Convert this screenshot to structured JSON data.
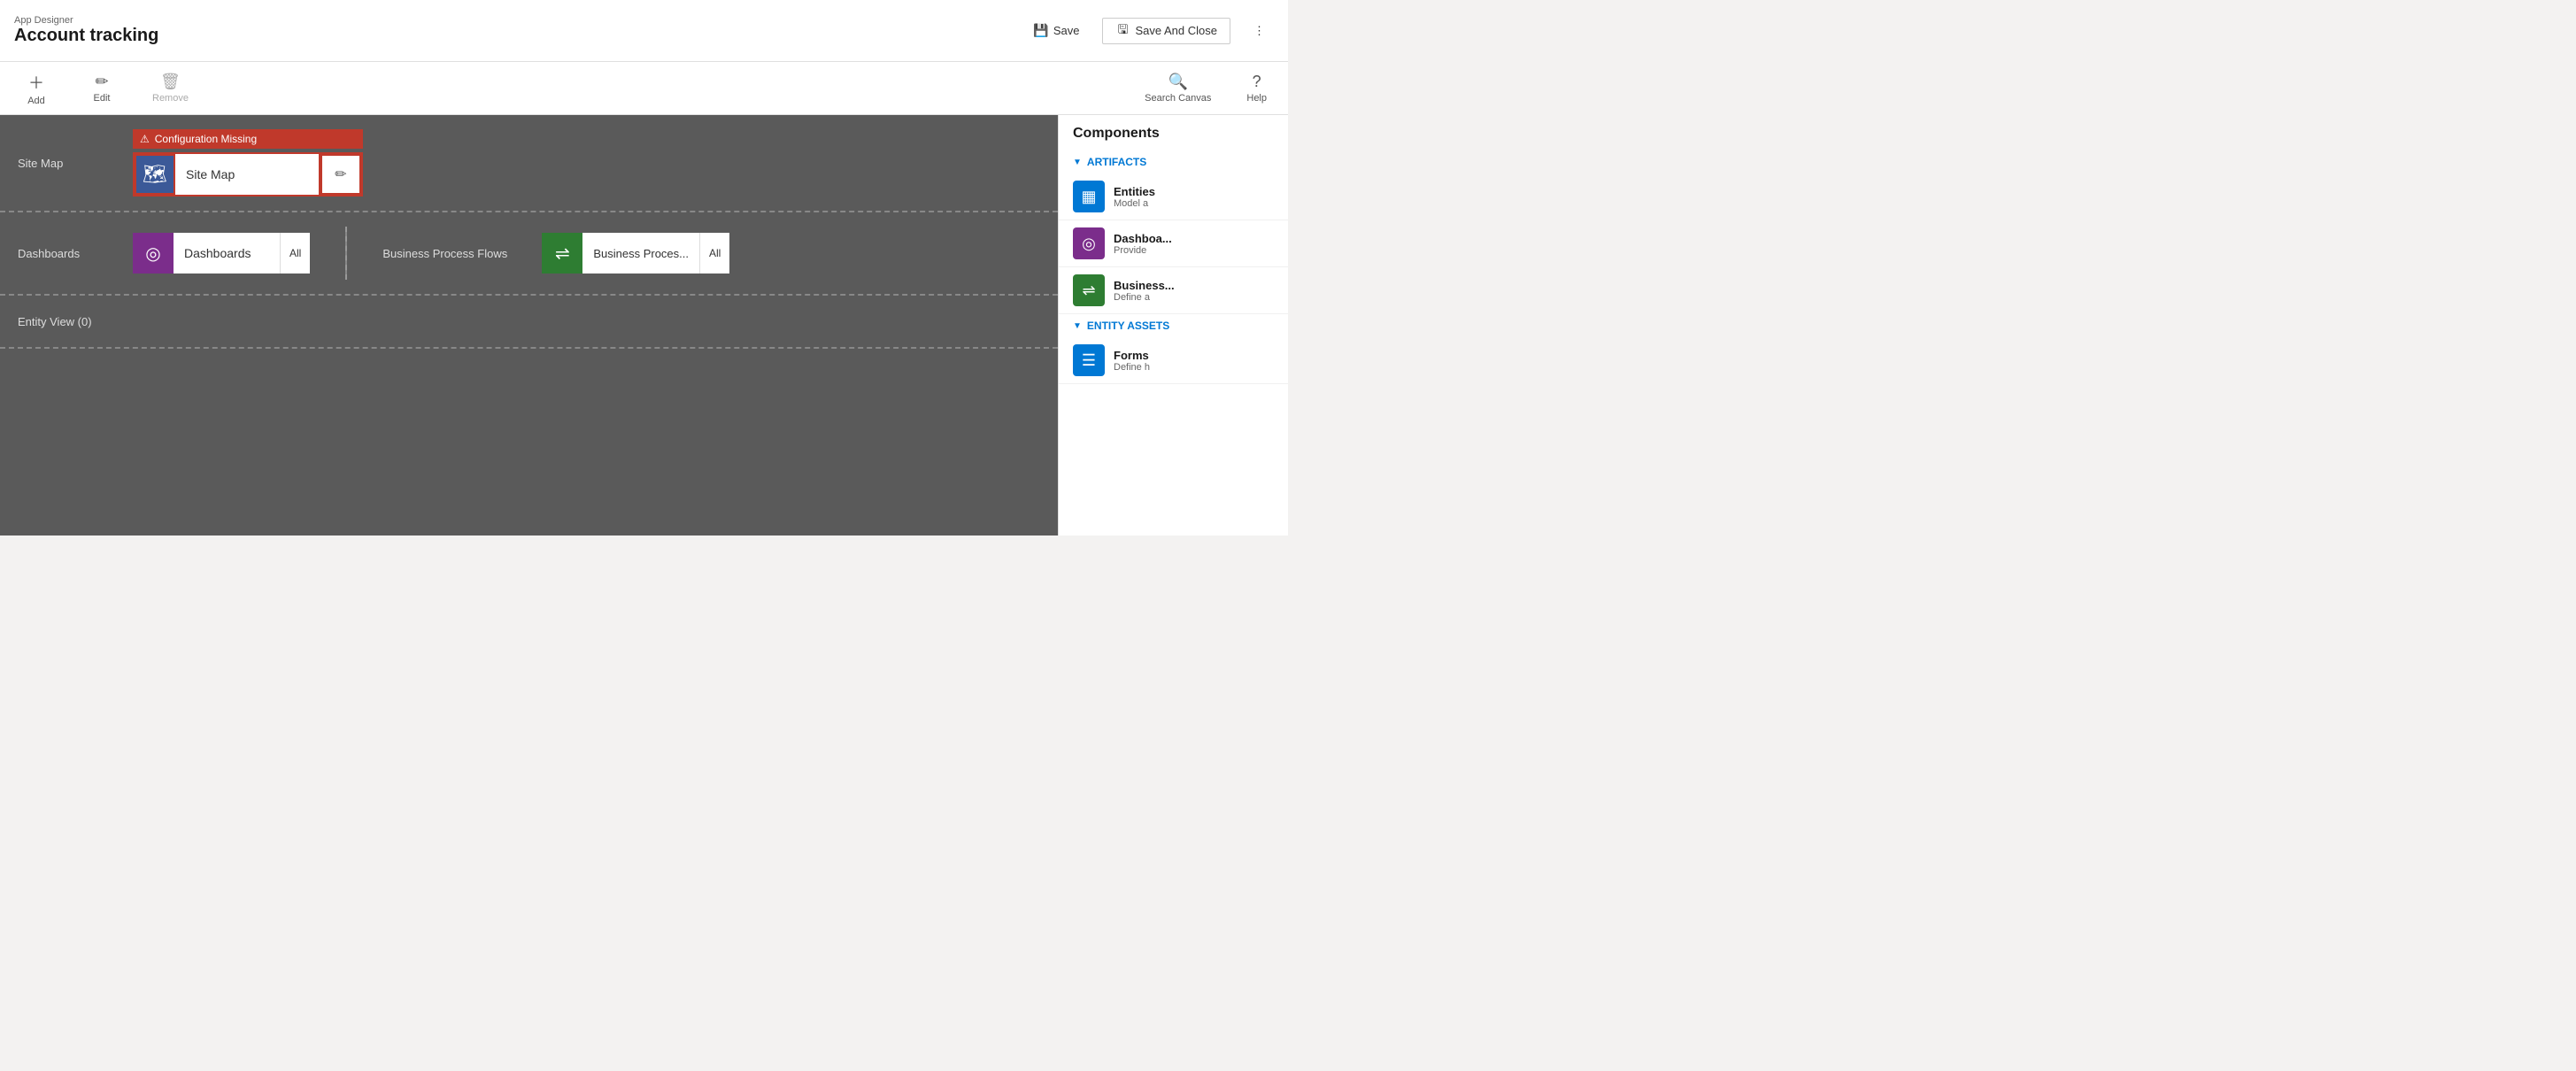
{
  "header": {
    "app_label": "App Designer",
    "app_title": "Account tracking",
    "save_label": "Save",
    "save_close_label": "Save And Close"
  },
  "toolbar": {
    "add_label": "Add",
    "edit_label": "Edit",
    "remove_label": "Remove",
    "search_canvas_label": "Search Canvas",
    "help_label": "Help"
  },
  "canvas": {
    "site_map_label": "Site Map",
    "config_missing_text": "Configuration Missing",
    "site_map_card_label": "Site Map",
    "dashboards_label": "Dashboards",
    "dashboards_card_label": "Dashboards",
    "dashboards_all": "All",
    "bpf_section_label": "Business Process Flows",
    "bpf_card_label": "Business Proces...",
    "bpf_all": "All",
    "entity_view_label": "Entity View (0)"
  },
  "components_panel": {
    "title": "Components",
    "artifacts_label": "ARTIFACTS",
    "entity_assets_label": "ENTITY ASSETS",
    "items": [
      {
        "name": "Entities",
        "desc": "Model a",
        "icon_type": "blue",
        "icon": "▦"
      },
      {
        "name": "Dashboa...",
        "desc": "Provide",
        "icon_type": "purple",
        "icon": "◎"
      },
      {
        "name": "Business...",
        "desc": "Define a",
        "icon_type": "green",
        "icon": "⇌"
      },
      {
        "name": "Forms",
        "desc": "Define h",
        "icon_type": "doc",
        "icon": "☰"
      }
    ]
  }
}
